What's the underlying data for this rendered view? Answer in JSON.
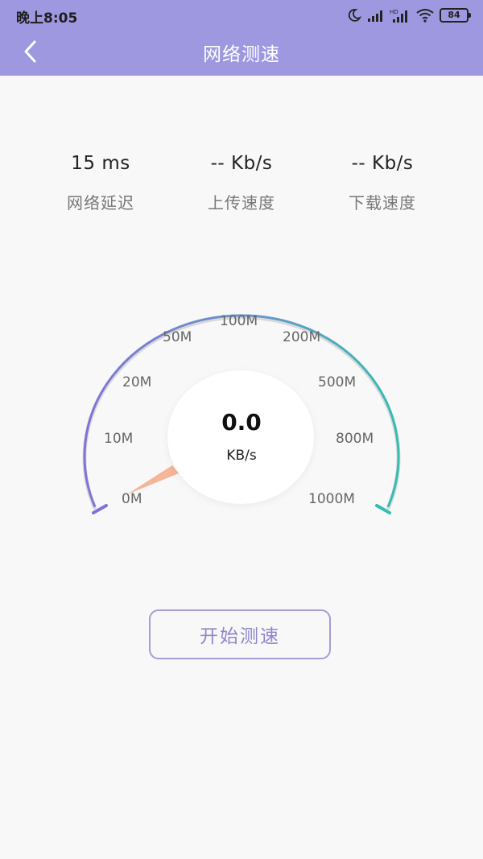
{
  "status_bar": {
    "time": "晚上8:05",
    "battery": "84"
  },
  "header": {
    "title": "网络测速"
  },
  "stats": [
    {
      "value": "15 ms",
      "label": "网络延迟"
    },
    {
      "value": "-- Kb/s",
      "label": "上传速度"
    },
    {
      "value": "-- Kb/s",
      "label": "下载速度"
    }
  ],
  "gauge": {
    "ticks": [
      "0M",
      "10M",
      "20M",
      "50M",
      "100M",
      "200M",
      "500M",
      "800M",
      "1000M"
    ],
    "value": "0.0",
    "unit": "KB/s"
  },
  "actions": {
    "start_label": "开始测速"
  },
  "colors": {
    "header_bg": "#9e98e0",
    "gauge_start": "#7f74d6",
    "gauge_end": "#34bdb2",
    "needle": "#f4b598",
    "button_text": "#8e86cc"
  }
}
